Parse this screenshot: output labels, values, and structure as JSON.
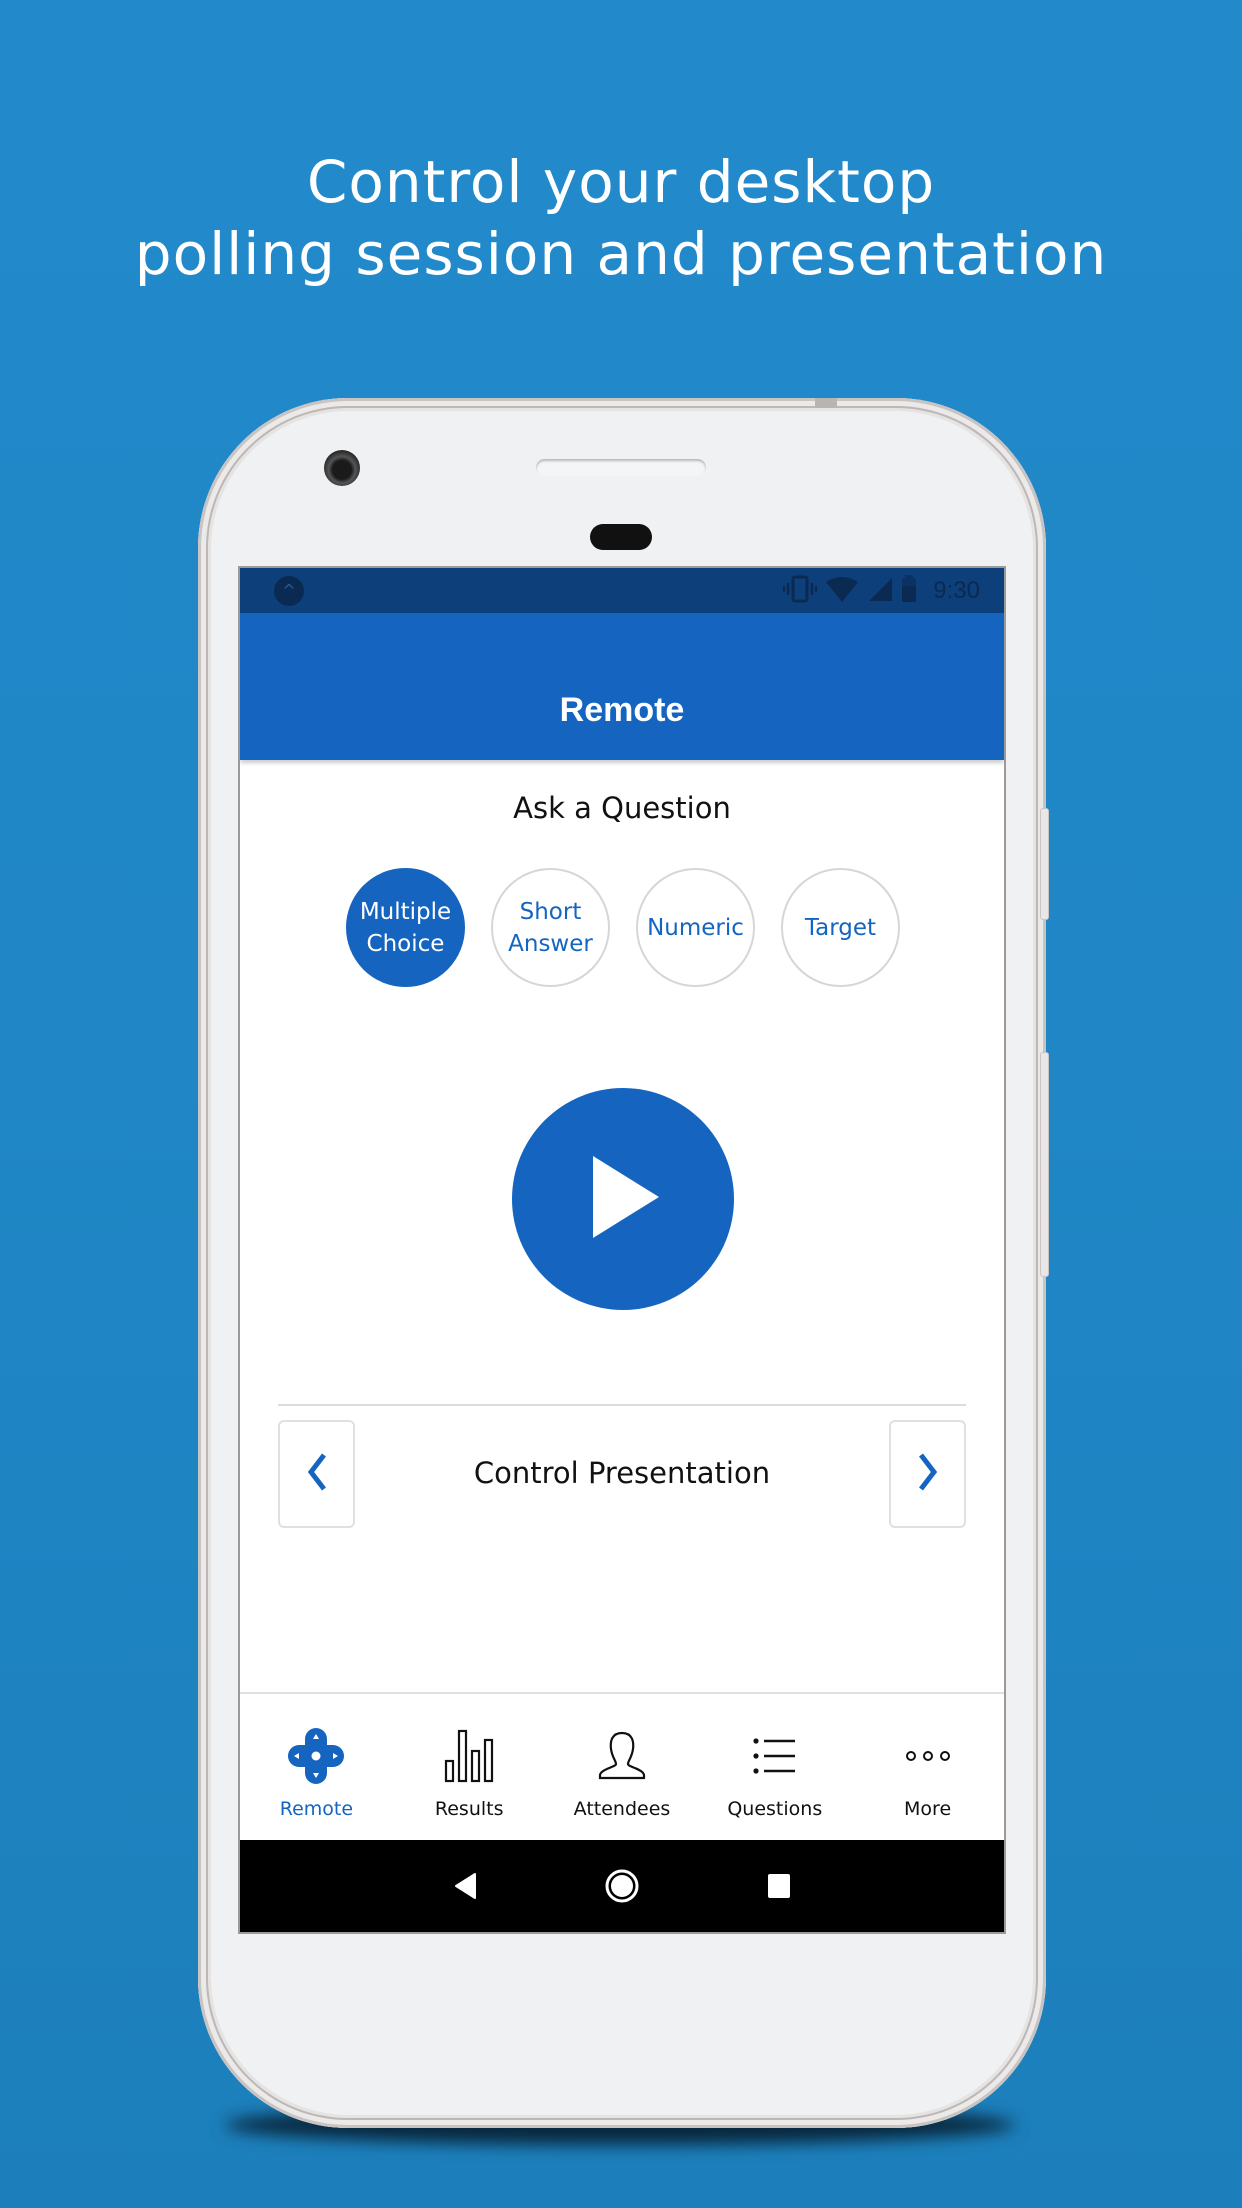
{
  "headline": {
    "line1": "Control your desktop",
    "line2": "polling session and presentation"
  },
  "status_bar": {
    "app_icon": "caret-up-icon",
    "icons": [
      "vibrate-icon",
      "wifi-icon",
      "cellular-signal-icon",
      "battery-icon"
    ],
    "time": "9:30"
  },
  "app_bar": {
    "title": "Remote"
  },
  "ask_question": {
    "title": "Ask a Question",
    "types": [
      {
        "label_line1": "Multiple",
        "label_line2": "Choice",
        "selected": true
      },
      {
        "label_line1": "Short",
        "label_line2": "Answer",
        "selected": false
      },
      {
        "label_line1": "Numeric",
        "label_line2": "",
        "selected": false
      },
      {
        "label_line1": "Target",
        "label_line2": "",
        "selected": false
      }
    ],
    "play_icon": "play-icon"
  },
  "presentation": {
    "label": "Control Presentation",
    "prev_icon": "chevron-left-icon",
    "next_icon": "chevron-right-icon"
  },
  "tabs": [
    {
      "label": "Remote",
      "icon": "dpad-icon",
      "active": true
    },
    {
      "label": "Results",
      "icon": "bar-chart-icon",
      "active": false
    },
    {
      "label": "Attendees",
      "icon": "person-icon",
      "active": false
    },
    {
      "label": "Questions",
      "icon": "list-icon",
      "active": false
    },
    {
      "label": "More",
      "icon": "more-horizontal-icon",
      "active": false
    }
  ],
  "system_nav": {
    "back": "back-icon",
    "home": "home-icon",
    "recents": "recents-icon"
  },
  "colors": {
    "background": "#228acb",
    "primary": "#1565c0",
    "status_bar": "#0d3f7b",
    "text": "#111111"
  }
}
